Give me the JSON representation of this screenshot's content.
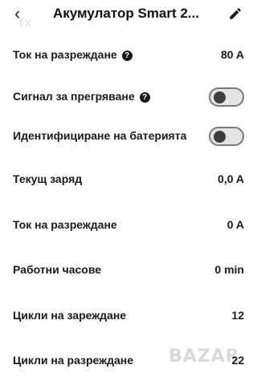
{
  "header": {
    "title": "Акумулатор Smart 2...",
    "watermark": "fx"
  },
  "rows": [
    {
      "label": "Ток на разреждане",
      "help": true,
      "value": "80 A"
    },
    {
      "label": "Сигнал за прегряване",
      "help": true,
      "toggle": false
    },
    {
      "label": "Идентифициране на батерията",
      "toggle": false
    },
    {
      "label": "Текущ заряд",
      "value": "0,0 A"
    },
    {
      "label": "Ток на разреждане",
      "value": "0 A"
    },
    {
      "label": "Работни часове",
      "value": "0 min"
    },
    {
      "label": "Цикли на зареждане",
      "value": "12"
    },
    {
      "label": "Цикли на разреждане",
      "value": "22"
    }
  ],
  "watermark_logo": "BAZAR"
}
